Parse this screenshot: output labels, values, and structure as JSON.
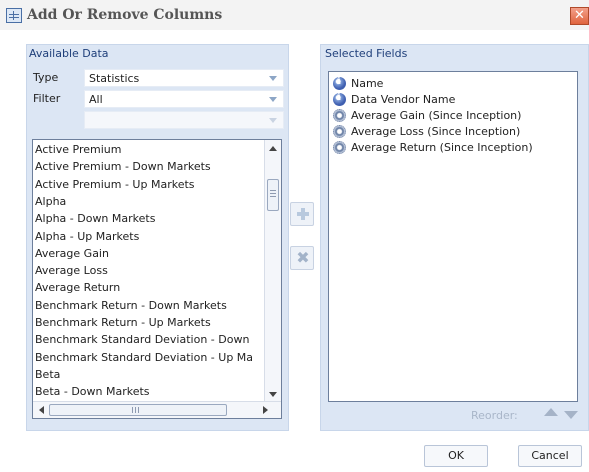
{
  "window": {
    "title": "Add Or Remove Columns",
    "close_glyph": "✕"
  },
  "available": {
    "header": "Available Data",
    "type_label": "Type",
    "type_value": "Statistics",
    "filter_label": "Filter",
    "filter_value": "All",
    "sub_value": "",
    "items": [
      "Active Premium",
      "Active Premium - Down Markets",
      "Active Premium - Up Markets",
      "Alpha",
      "Alpha - Down Markets",
      "Alpha - Up Markets",
      "Average Gain",
      "Average Loss",
      "Average Return",
      "Benchmark Return - Down Markets",
      "Benchmark Return - Up Markets",
      "Benchmark Standard Deviation - Down",
      "Benchmark Standard Deviation - Up Ma",
      "Beta",
      "Beta - Down Markets"
    ],
    "scroll_position": 0.1
  },
  "selected": {
    "header": "Selected Fields",
    "items": [
      {
        "label": "Name",
        "icon": "info-icon"
      },
      {
        "label": "Data Vendor Name",
        "icon": "info-icon"
      },
      {
        "label": "Average Gain (Since Inception)",
        "icon": "gear-icon"
      },
      {
        "label": "Average Loss (Since Inception)",
        "icon": "gear-icon"
      },
      {
        "label": "Average Return (Since Inception)",
        "icon": "gear-icon"
      }
    ],
    "reorder_label": "Reorder:"
  },
  "buttons": {
    "ok": "OK",
    "cancel": "Cancel"
  }
}
